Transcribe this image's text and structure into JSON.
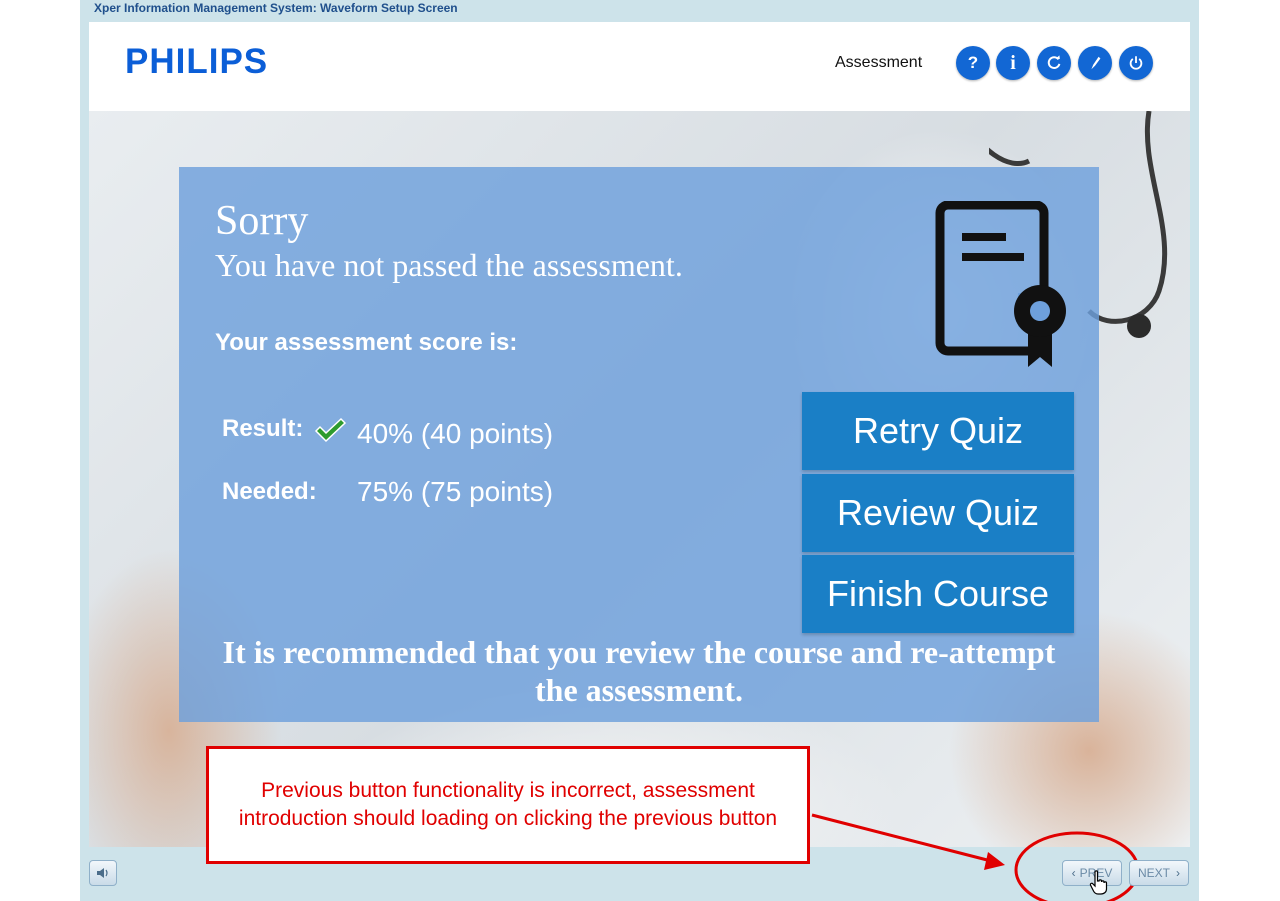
{
  "window": {
    "title": "Xper Information Management System: Waveform Setup Screen"
  },
  "header": {
    "logo": "PHILIPS",
    "section": "Assessment",
    "buttons": [
      {
        "name": "help",
        "glyph": "?"
      },
      {
        "name": "info",
        "glyph": "i"
      },
      {
        "name": "refresh",
        "glyph": "refresh"
      },
      {
        "name": "compass",
        "glyph": "compass"
      },
      {
        "name": "power",
        "glyph": "power"
      }
    ]
  },
  "result_panel": {
    "title": "Sorry",
    "subtitle": "You have not passed the assessment.",
    "score_heading": "Your assessment score is:",
    "result_label": "Result:",
    "result_value": "40% (40 points)",
    "needed_label": "Needed:",
    "needed_value": "75% (75 points)",
    "retry_label": "Retry Quiz",
    "review_label": "Review Quiz",
    "finish_label": "Finish Course",
    "recommendation": "It is recommended that you review the course and re-attempt the assessment."
  },
  "annotation": {
    "text": "Previous button functionality is incorrect, assessment introduction should loading on clicking the previous button",
    "color": "#e00000"
  },
  "footer": {
    "prev_label": "PREV",
    "next_label": "NEXT"
  },
  "colors": {
    "brand": "#0b5ed7",
    "panel": "#6ea0dc",
    "action_button": "#1a7fc6",
    "header_button": "#1267d4"
  }
}
